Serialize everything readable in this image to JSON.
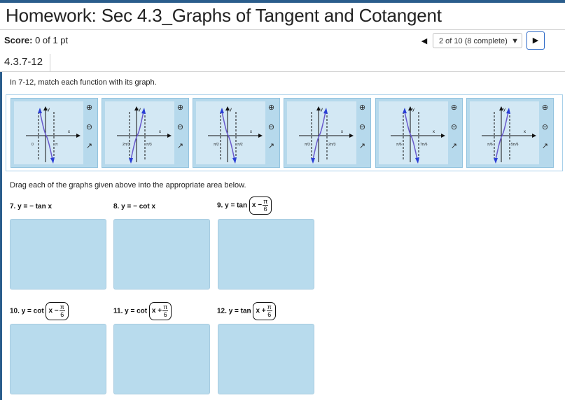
{
  "header": {
    "title": "Homework: Sec 4.3_Graphs of Tangent and Cotangent",
    "score_label": "Score:",
    "score_value": "0 of 1 pt",
    "progress": "2 of 10 (8 complete)",
    "prev_icon": "◀",
    "next_icon": "▶",
    "caret_icon": "▼"
  },
  "question": {
    "id": "4.3.7-12",
    "instructions": "In 7-12, match each function with its graph.",
    "drag_instructions": "Drag each of the graphs given above into the appropriate area below."
  },
  "graph_icons": {
    "zoom_in": "⊕",
    "zoom_out": "⊖",
    "popout": "↗"
  },
  "graphs": [
    {
      "tick1": "0",
      "tick2": "π",
      "xlabel": "x",
      "ylabel": "y"
    },
    {
      "tick1": "2π/3",
      "tick2": "π/3",
      "xlabel": "x",
      "ylabel": "y"
    },
    {
      "tick1": "π/2",
      "tick2": "π/2",
      "xlabel": "x",
      "ylabel": "y"
    },
    {
      "tick1": "π/3",
      "tick2": "2π/3",
      "xlabel": "x",
      "ylabel": "y"
    },
    {
      "tick1": "π/6",
      "tick2": "7π/6",
      "xlabel": "x",
      "ylabel": "y"
    },
    {
      "tick1": "π/6",
      "tick2": "5π/6",
      "xlabel": "x",
      "ylabel": "y"
    }
  ],
  "functions": [
    {
      "num": "7.",
      "text": "y = − tan x"
    },
    {
      "num": "8.",
      "text": "y = − cot x"
    },
    {
      "num": "9.",
      "prefix": "y = tan",
      "inner": "x −",
      "num_frac": "π",
      "den_frac": "6"
    },
    {
      "num": "10.",
      "prefix": "y = cot",
      "inner": "x −",
      "num_frac": "π",
      "den_frac": "6"
    },
    {
      "num": "11.",
      "prefix": "y = cot",
      "inner": "x +",
      "num_frac": "π",
      "den_frac": "6"
    },
    {
      "num": "12.",
      "prefix": "y = tan",
      "inner": "x +",
      "num_frac": "π",
      "den_frac": "6"
    }
  ]
}
